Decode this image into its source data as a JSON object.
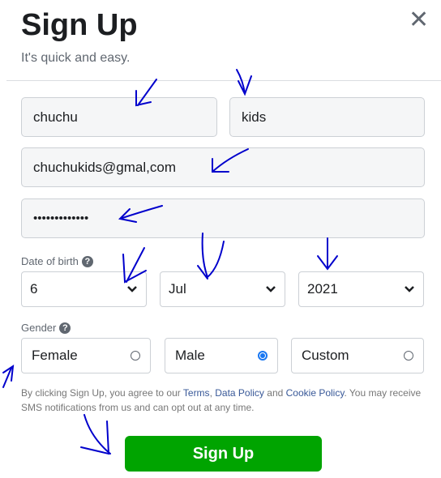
{
  "header": {
    "title": "Sign Up",
    "subtitle": "It's quick and easy.",
    "close_icon": "close-icon"
  },
  "form": {
    "first_name": "chuchu",
    "last_name": "kids",
    "email": "chuchukids@gmal,com",
    "password": "•••••••••••••",
    "dob_label": "Date of birth",
    "dob": {
      "day": "6",
      "month": "Jul",
      "year": "2021"
    },
    "gender_label": "Gender",
    "gender_options": [
      {
        "label": "Female",
        "selected": false
      },
      {
        "label": "Male",
        "selected": true
      },
      {
        "label": "Custom",
        "selected": false
      }
    ],
    "help_glyph": "?"
  },
  "terms": {
    "t1": "By clicking Sign Up, you agree to our ",
    "terms": "Terms",
    "sep": ", ",
    "data_policy": "Data Policy",
    "and": " and ",
    "cookie_policy": "Cookie Policy",
    "t2": ". You may receive SMS notifications from us and can opt out at any time."
  },
  "submit_label": "Sign Up",
  "colors": {
    "button": "#00a400",
    "link": "#385898",
    "radio_selected": "#1877f2",
    "annotation": "#0000cc"
  }
}
